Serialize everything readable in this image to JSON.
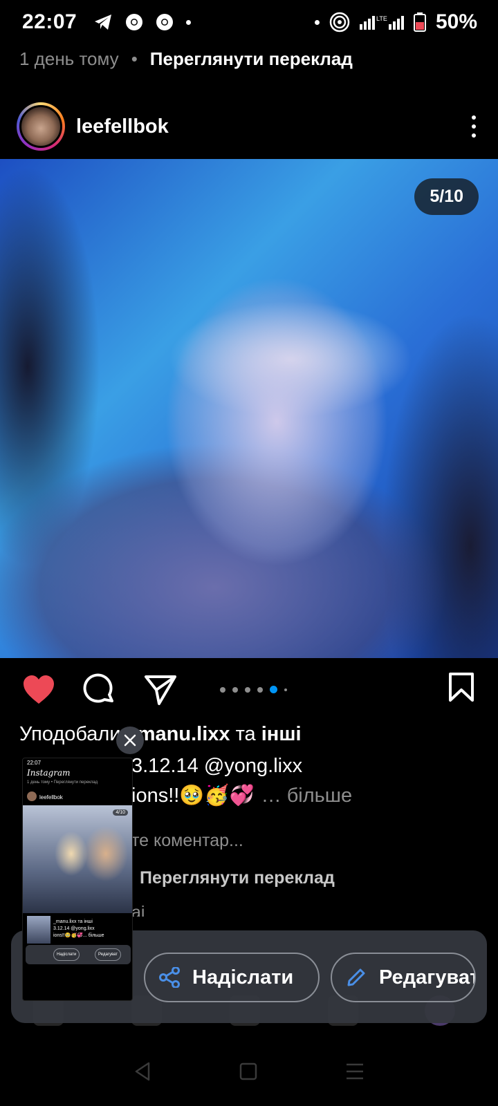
{
  "status_bar": {
    "time": "22:07",
    "battery": "50%",
    "network": "LTE"
  },
  "previous_post": {
    "time_ago": "1 день тому",
    "separator": "•",
    "translate_label": "Переглянути переклад"
  },
  "post": {
    "username": "leefellbok",
    "counter": "5/10",
    "carousel_active_index": 4,
    "liked": true,
    "likes": {
      "prefix": "Уподобали",
      "user": "_manu.lixx",
      "conjunction": "та",
      "others": "інші"
    },
    "caption_line1": "3.12.14 @yong.lixx",
    "caption_line2": "ions!!🥹🥳💞",
    "more_label": "… більше",
    "comment_placeholder": "те коментар...",
    "translate_label": "Переглянути переклад",
    "truncated_text": "ai"
  },
  "share_tray": {
    "send_label": "Надіслати",
    "edit_label": "Редагуват"
  },
  "thumbnail": {
    "status_time": "22:07",
    "brand": "Instagram",
    "subline": "1 день тому • Переглянути переклад",
    "username": "leefellbok",
    "counter": "4/10",
    "caption_a": "_manu.lixx та інші",
    "caption_b": "3.12.14 @yong.lixx",
    "caption_c": "ions!!🥹🥳💞... більше",
    "send_label": "Надіслати",
    "edit_label": "Редагуват"
  },
  "colors": {
    "like_red": "#ed4956",
    "accent_blue": "#0095f6",
    "tray_bg": "#34373e",
    "tray_icon_blue": "#4a8fe7"
  }
}
